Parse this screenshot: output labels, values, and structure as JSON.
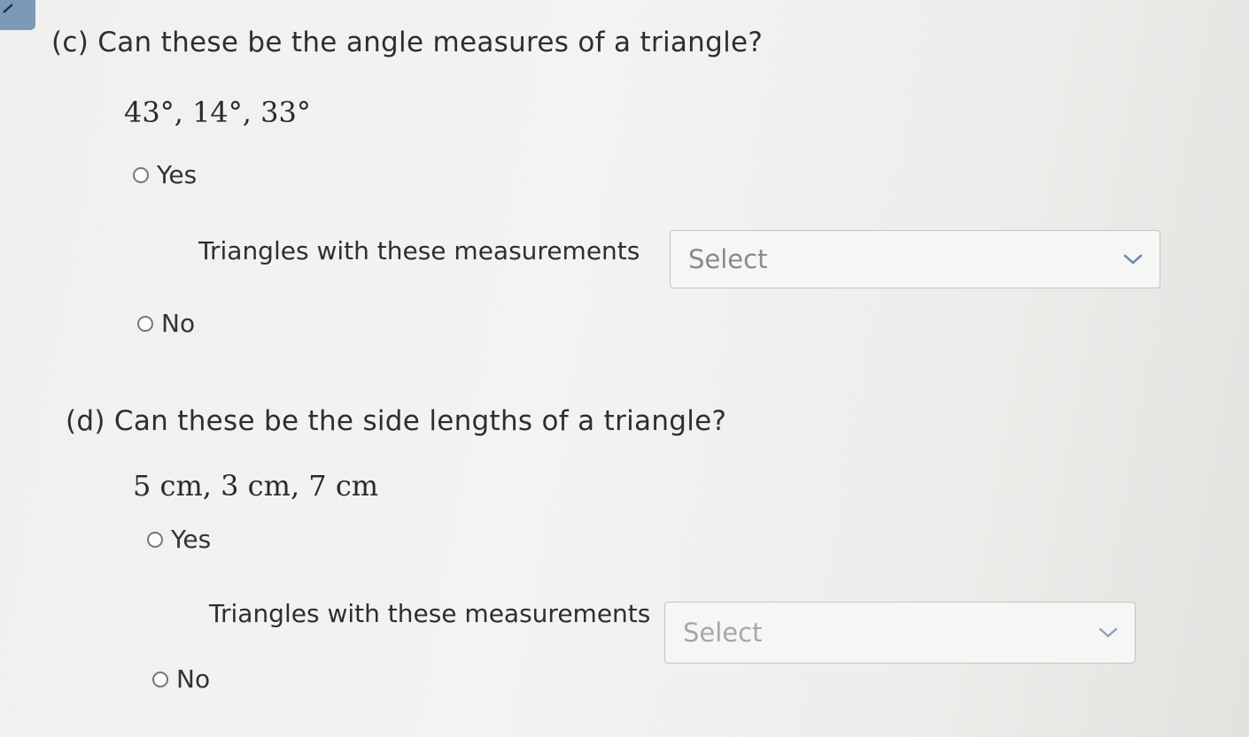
{
  "part_c": {
    "question": "(c) Can these be the angle measures of a triangle?",
    "values": "43°, 14°, 33°",
    "option_yes": "Yes",
    "followup_text": "Triangles with these measurements",
    "select_value": "Select",
    "option_no": "No"
  },
  "part_d": {
    "question": "(d) Can these be the side lengths of a triangle?",
    "values": "5 cm, 3 cm, 7 cm",
    "option_yes": "Yes",
    "followup_text": "Triangles with these measurements",
    "select_value": "Select",
    "option_no": "No"
  }
}
